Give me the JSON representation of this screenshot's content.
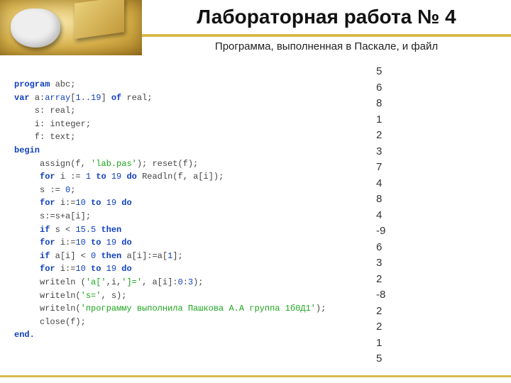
{
  "header": {
    "title": "Лабораторная работа № 4",
    "subtitle": "Программа, выполненная в Паскале, и файл"
  },
  "code": [
    [
      {
        "t": "program ",
        "c": "kw"
      },
      {
        "t": "abc;",
        "c": "op"
      }
    ],
    [
      {
        "t": "var ",
        "c": "kw"
      },
      {
        "t": "a:",
        "c": "op"
      },
      {
        "t": "array",
        "c": "tp"
      },
      {
        "t": "[",
        "c": "op"
      },
      {
        "t": "1",
        "c": "num"
      },
      {
        "t": "..",
        "c": "op"
      },
      {
        "t": "19",
        "c": "num"
      },
      {
        "t": "] ",
        "c": "op"
      },
      {
        "t": "of ",
        "c": "kw"
      },
      {
        "t": "real;",
        "c": "op"
      }
    ],
    [
      {
        "t": "    s: real;",
        "c": "op"
      }
    ],
    [
      {
        "t": "    i: integer;",
        "c": "op"
      }
    ],
    [
      {
        "t": "    f: text;",
        "c": "op"
      }
    ],
    [
      {
        "t": "begin",
        "c": "kw"
      }
    ],
    [
      {
        "t": "     assign(f, ",
        "c": "op"
      },
      {
        "t": "'lab.pas'",
        "c": "str"
      },
      {
        "t": "); reset(f);",
        "c": "op"
      }
    ],
    [
      {
        "t": "     ",
        "c": "op"
      },
      {
        "t": "for ",
        "c": "kw"
      },
      {
        "t": "i := ",
        "c": "op"
      },
      {
        "t": "1 ",
        "c": "num"
      },
      {
        "t": "to ",
        "c": "kw"
      },
      {
        "t": "19 ",
        "c": "num"
      },
      {
        "t": "do ",
        "c": "kw"
      },
      {
        "t": "Readln(f, a[i]);",
        "c": "op"
      }
    ],
    [
      {
        "t": "     s := ",
        "c": "op"
      },
      {
        "t": "0",
        "c": "num"
      },
      {
        "t": ";",
        "c": "op"
      }
    ],
    [
      {
        "t": "     ",
        "c": "op"
      },
      {
        "t": "for ",
        "c": "kw"
      },
      {
        "t": "i:=",
        "c": "op"
      },
      {
        "t": "10 ",
        "c": "num"
      },
      {
        "t": "to ",
        "c": "kw"
      },
      {
        "t": "19 ",
        "c": "num"
      },
      {
        "t": "do",
        "c": "kw"
      }
    ],
    [
      {
        "t": "     s:=s+a[i];",
        "c": "op"
      }
    ],
    [
      {
        "t": "     ",
        "c": "op"
      },
      {
        "t": "if ",
        "c": "kw"
      },
      {
        "t": "s < ",
        "c": "op"
      },
      {
        "t": "15.5 ",
        "c": "num"
      },
      {
        "t": "then",
        "c": "kw"
      }
    ],
    [
      {
        "t": "     ",
        "c": "op"
      },
      {
        "t": "for ",
        "c": "kw"
      },
      {
        "t": "i:=",
        "c": "op"
      },
      {
        "t": "10 ",
        "c": "num"
      },
      {
        "t": "to ",
        "c": "kw"
      },
      {
        "t": "19 ",
        "c": "num"
      },
      {
        "t": "do",
        "c": "kw"
      }
    ],
    [
      {
        "t": "     ",
        "c": "op"
      },
      {
        "t": "if ",
        "c": "kw"
      },
      {
        "t": "a[i] < ",
        "c": "op"
      },
      {
        "t": "0 ",
        "c": "num"
      },
      {
        "t": "then ",
        "c": "kw"
      },
      {
        "t": "a[i]:=a[",
        "c": "op"
      },
      {
        "t": "1",
        "c": "num"
      },
      {
        "t": "];",
        "c": "op"
      }
    ],
    [
      {
        "t": "     ",
        "c": "op"
      },
      {
        "t": "for ",
        "c": "kw"
      },
      {
        "t": "i:=",
        "c": "op"
      },
      {
        "t": "10 ",
        "c": "num"
      },
      {
        "t": "to ",
        "c": "kw"
      },
      {
        "t": "19 ",
        "c": "num"
      },
      {
        "t": "do",
        "c": "kw"
      }
    ],
    [
      {
        "t": "     writeln (",
        "c": "op"
      },
      {
        "t": "'a['",
        "c": "str"
      },
      {
        "t": ",i,",
        "c": "op"
      },
      {
        "t": "']='",
        "c": "str"
      },
      {
        "t": ", a[i]:",
        "c": "op"
      },
      {
        "t": "0",
        "c": "num"
      },
      {
        "t": ":",
        "c": "op"
      },
      {
        "t": "3",
        "c": "num"
      },
      {
        "t": ");",
        "c": "op"
      }
    ],
    [
      {
        "t": "     writeln(",
        "c": "op"
      },
      {
        "t": "'s='",
        "c": "str"
      },
      {
        "t": ", s);",
        "c": "op"
      }
    ],
    [
      {
        "t": "     writeln(",
        "c": "op"
      },
      {
        "t": "'программу выполнила Пашкова А.А группа 1б0Д1'",
        "c": "str"
      },
      {
        "t": ");",
        "c": "op"
      }
    ],
    [
      {
        "t": "     close(f);",
        "c": "op"
      }
    ],
    [
      {
        "t": "end.",
        "c": "kw"
      }
    ]
  ],
  "file_data": [
    "5",
    "6",
    "8",
    "1",
    "2",
    "3",
    "7",
    "4",
    "8",
    "4",
    "-9",
    "6",
    "3",
    "2",
    "-8",
    "2",
    "2",
    "1",
    "5"
  ]
}
